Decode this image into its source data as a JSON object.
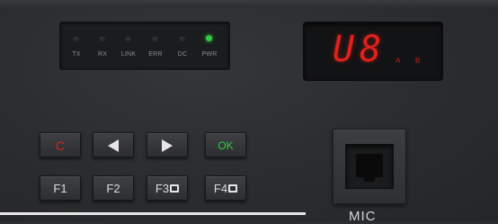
{
  "led_panel": {
    "leds": [
      {
        "label": "TX",
        "on": false
      },
      {
        "label": "RX",
        "on": false
      },
      {
        "label": "LINK",
        "on": false
      },
      {
        "label": "ERR",
        "on": false
      },
      {
        "label": "DC",
        "on": false
      },
      {
        "label": "PWR",
        "on": true
      }
    ],
    "on_color": "#2ecc40"
  },
  "display": {
    "digit_1": "U",
    "digit_2": "8",
    "indicator_a": "A",
    "indicator_b": "B",
    "color": "#e0211b"
  },
  "buttons": {
    "cancel": "C",
    "ok": "OK",
    "f1": "F1",
    "f2": "F2",
    "f3": "F3",
    "f4": "F4",
    "left_icon": "arrow-left-icon",
    "right_icon": "arrow-right-icon"
  },
  "mic": {
    "label": "MIC"
  }
}
